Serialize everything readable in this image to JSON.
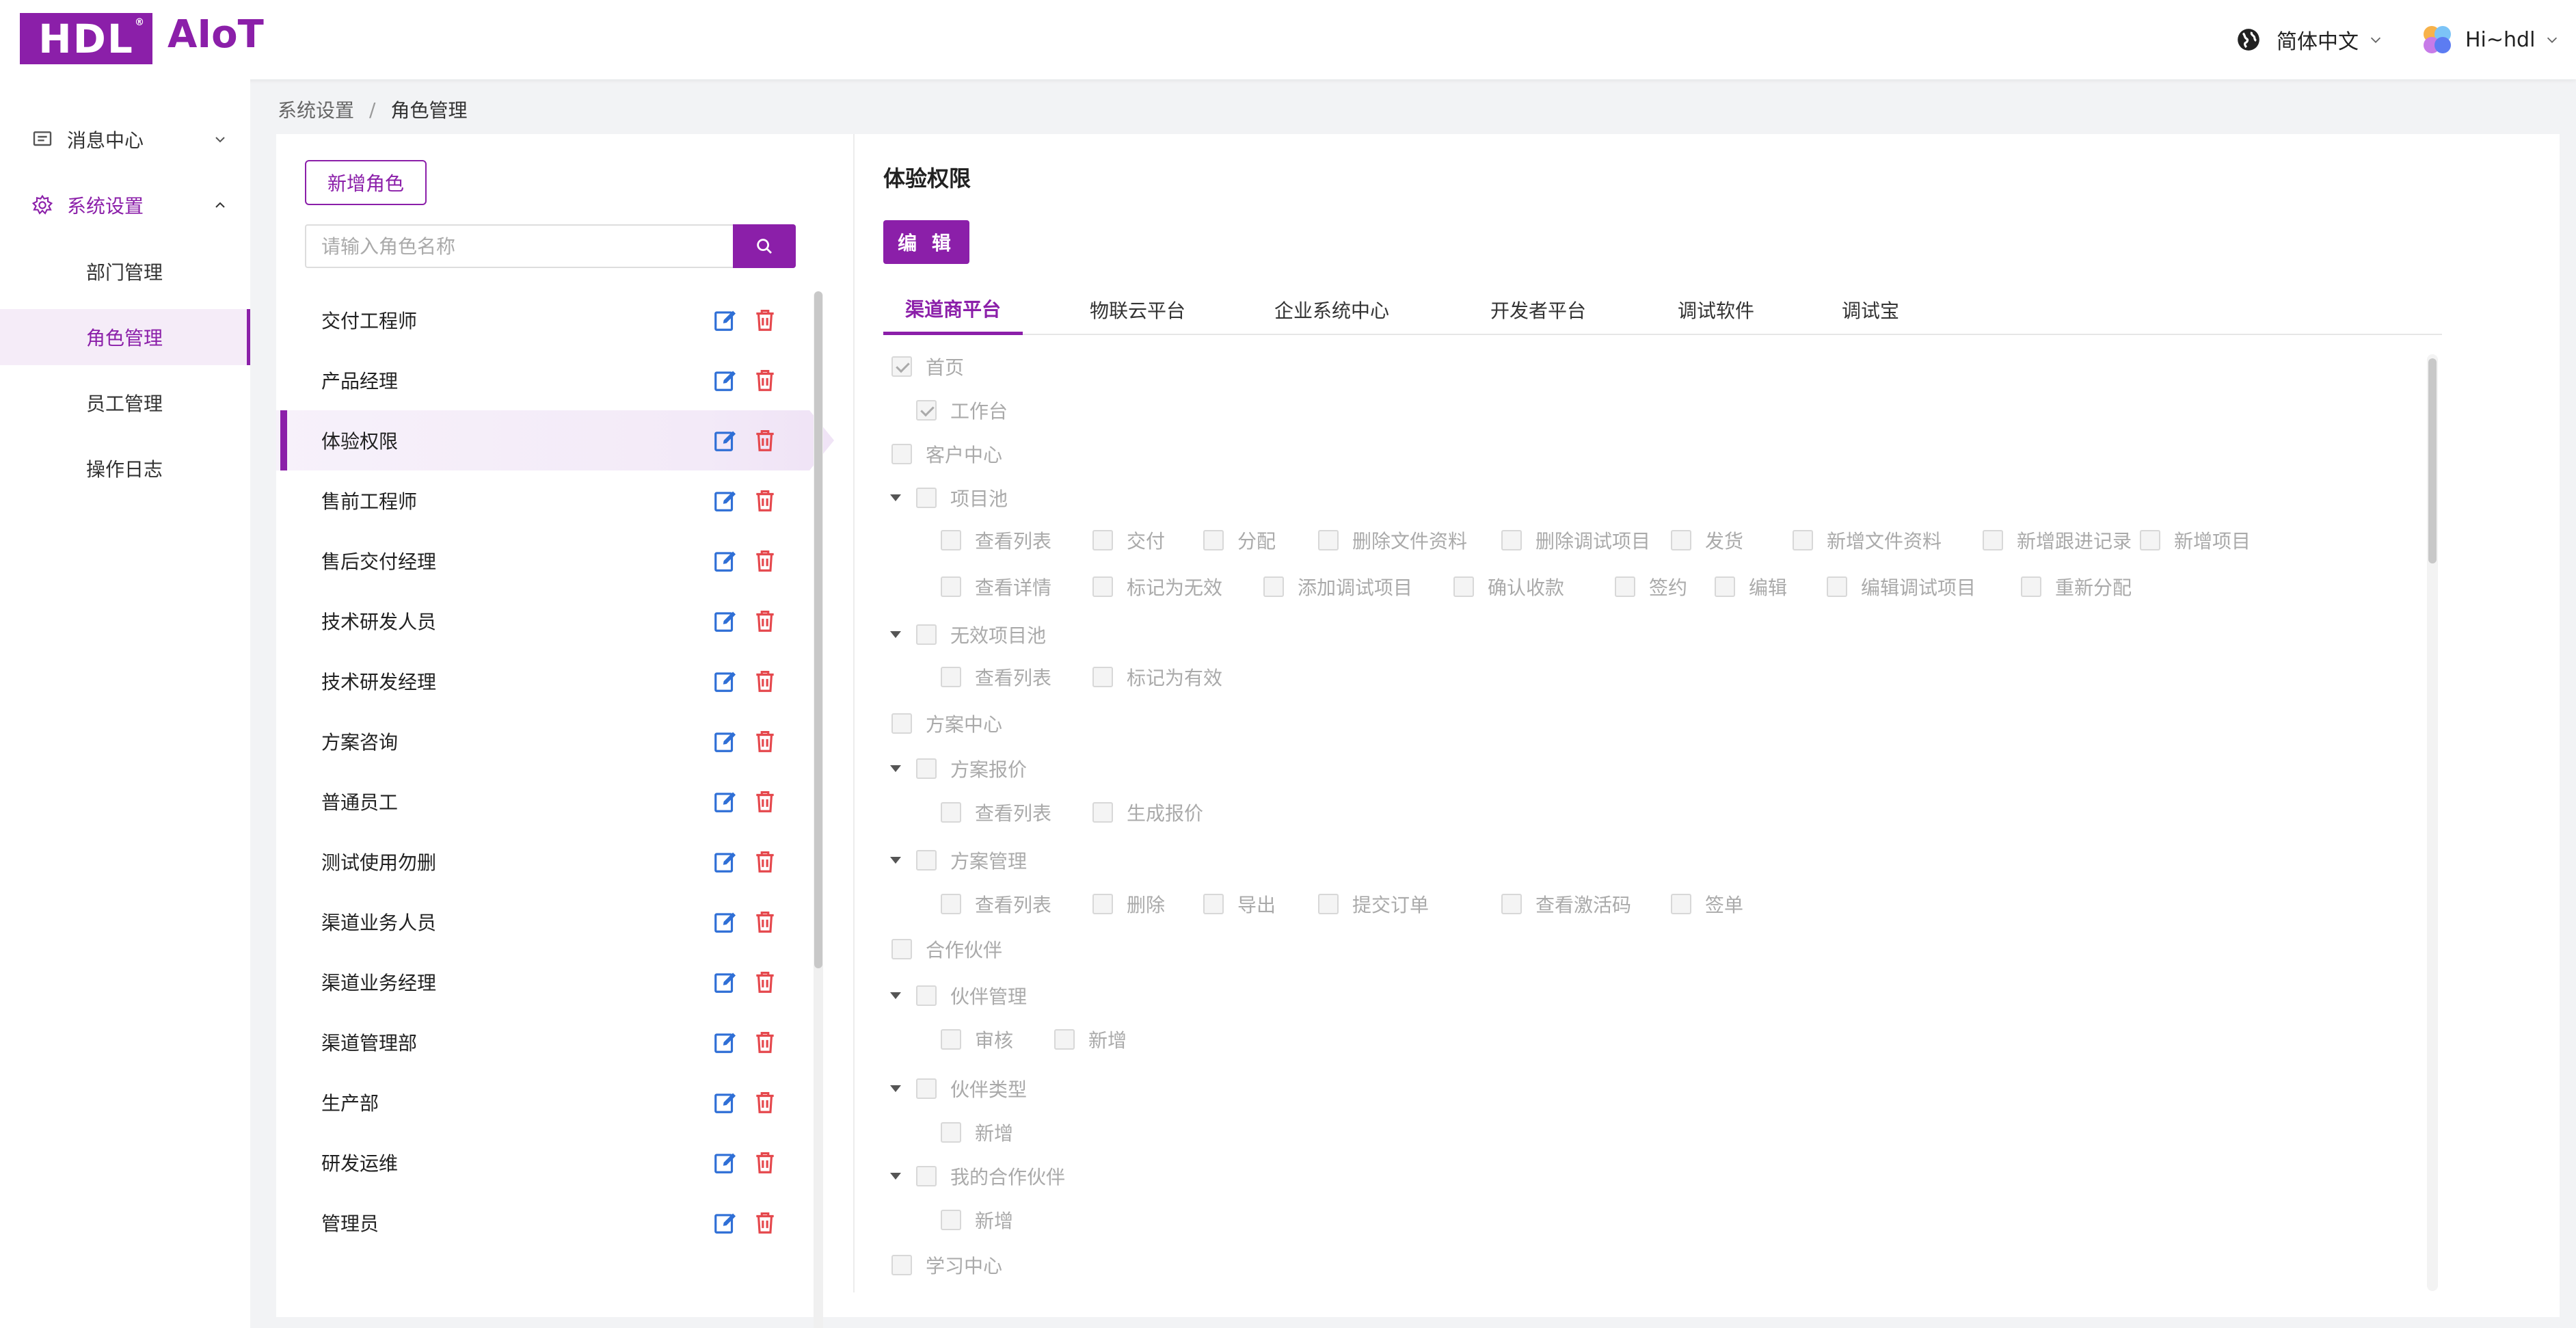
{
  "header": {
    "logo": "HDL",
    "logo_mark": "®",
    "app_name": "AIoT",
    "language": "简体中文",
    "user": "Hi~hdl"
  },
  "sidebar": {
    "groups": [
      {
        "label": "消息中心",
        "icon": "message-icon",
        "expanded": false
      },
      {
        "label": "系统设置",
        "icon": "gear-icon",
        "expanded": true
      }
    ],
    "sub_items": [
      {
        "label": "部门管理",
        "active": false
      },
      {
        "label": "角色管理",
        "active": true
      },
      {
        "label": "员工管理",
        "active": false
      },
      {
        "label": "操作日志",
        "active": false
      }
    ]
  },
  "breadcrumb": {
    "parent": "系统设置",
    "separator": "/",
    "current": "角色管理"
  },
  "roles": {
    "add_label": "新增角色",
    "search_placeholder": "请输入角色名称",
    "items": [
      "交付工程师",
      "产品经理",
      "体验权限",
      "售前工程师",
      "售后交付经理",
      "技术研发人员",
      "技术研发经理",
      "方案咨询",
      "普通员工",
      "测试使用勿删",
      "渠道业务人员",
      "渠道业务经理",
      "渠道管理部",
      "生产部",
      "研发运维",
      "管理员"
    ],
    "active_index": 2
  },
  "permissions": {
    "title": "体验权限",
    "edit_label": "编 辑",
    "tabs": [
      "渠道商平台",
      "物联云平台",
      "企业系统中心",
      "开发者平台",
      "调试软件",
      "调试宝"
    ],
    "active_tab": 0,
    "tree": {
      "home": "首页",
      "workbench": "工作台",
      "customer_center": "客户中心",
      "project_pool": "项目池",
      "pp_row1": [
        "查看列表",
        "交付",
        "分配",
        "删除文件资料",
        "删除调试项目",
        "发货",
        "新增文件资料",
        "新增跟进记录",
        "新增项目"
      ],
      "pp_row2": [
        "查看详情",
        "标记为无效",
        "添加调试项目",
        "确认收款",
        "签约",
        "编辑",
        "编辑调试项目",
        "重新分配"
      ],
      "invalid_pool": "无效项目池",
      "ip_items": [
        "查看列表",
        "标记为有效"
      ],
      "solution_center": "方案中心",
      "quote": "方案报价",
      "quote_items": [
        "查看列表",
        "生成报价"
      ],
      "solution_mgmt": "方案管理",
      "sm_items": [
        "查看列表",
        "删除",
        "导出",
        "提交订单",
        "查看激活码",
        "签单"
      ],
      "partners": "合作伙伴",
      "partner_mgmt": "伙伴管理",
      "pm_items": [
        "审核",
        "新增"
      ],
      "partner_type": "伙伴类型",
      "pt_items": [
        "新增"
      ],
      "my_partners": "我的合作伙伴",
      "mp_items": [
        "新增"
      ],
      "learning": "学习中心"
    }
  },
  "colors": {
    "brand": "#8b1fa9",
    "danger": "#e5484d",
    "edit_blue": "#2f6fd6"
  }
}
